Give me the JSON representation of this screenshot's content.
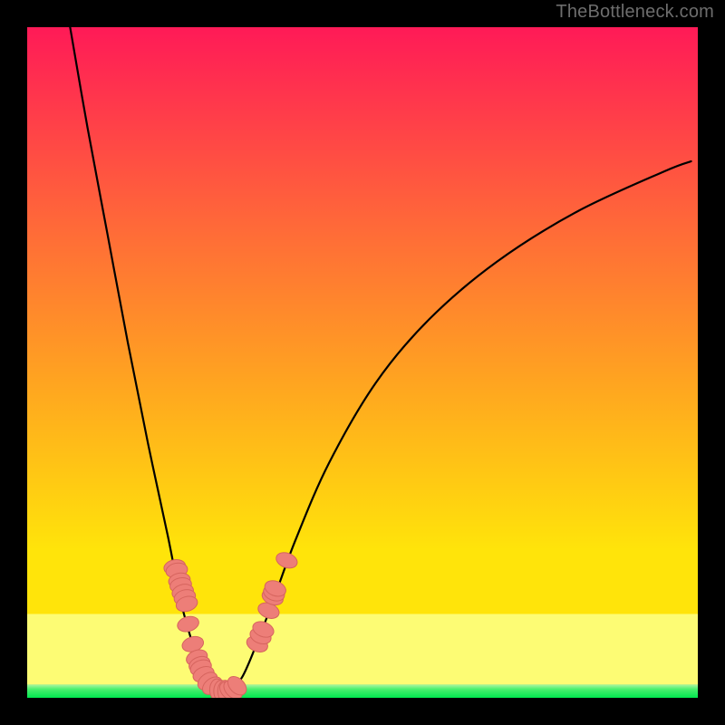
{
  "watermark": "TheBottleneck.com",
  "chart_data": {
    "type": "line",
    "title": "",
    "xlabel": "",
    "ylabel": "",
    "xlim": [
      0,
      100
    ],
    "ylim": [
      0,
      100
    ],
    "grid": false,
    "legend": false,
    "series": [
      {
        "name": "bottleneck-curve",
        "x": [
          6.4,
          9.0,
          12.0,
          15.0,
          18.0,
          21.0,
          23.0,
          25.0,
          26.5,
          28.0,
          30.0,
          32.0,
          34.0,
          36.5,
          40.0,
          45.0,
          52.0,
          60.0,
          70.0,
          82.0,
          95.0,
          99.0
        ],
        "values": [
          100.0,
          85.0,
          69.0,
          53.0,
          38.0,
          24.0,
          14.0,
          7.0,
          3.0,
          1.0,
          1.0,
          3.0,
          7.5,
          14.0,
          23.5,
          35.0,
          47.0,
          56.5,
          65.0,
          72.5,
          78.5,
          80.0
        ]
      }
    ],
    "points": [
      {
        "x": 22.0,
        "y": 19.5
      },
      {
        "x": 22.3,
        "y": 19.0
      },
      {
        "x": 22.7,
        "y": 17.5
      },
      {
        "x": 22.9,
        "y": 16.8
      },
      {
        "x": 23.2,
        "y": 15.8
      },
      {
        "x": 23.5,
        "y": 15.0
      },
      {
        "x": 23.8,
        "y": 14.0
      },
      {
        "x": 24.0,
        "y": 11.0
      },
      {
        "x": 24.7,
        "y": 8.0
      },
      {
        "x": 25.3,
        "y": 6.0
      },
      {
        "x": 25.7,
        "y": 5.0
      },
      {
        "x": 25.9,
        "y": 4.5
      },
      {
        "x": 26.3,
        "y": 3.5
      },
      {
        "x": 26.9,
        "y": 2.5
      },
      {
        "x": 27.6,
        "y": 1.8
      },
      {
        "x": 28.3,
        "y": 1.2
      },
      {
        "x": 28.9,
        "y": 1.0
      },
      {
        "x": 29.5,
        "y": 1.0
      },
      {
        "x": 30.1,
        "y": 1.0
      },
      {
        "x": 30.7,
        "y": 1.2
      },
      {
        "x": 31.3,
        "y": 1.8
      },
      {
        "x": 34.3,
        "y": 8.0
      },
      {
        "x": 34.8,
        "y": 9.2
      },
      {
        "x": 35.2,
        "y": 10.2
      },
      {
        "x": 36.0,
        "y": 13.0
      },
      {
        "x": 36.6,
        "y": 15.0
      },
      {
        "x": 36.8,
        "y": 15.6
      },
      {
        "x": 37.0,
        "y": 16.3
      },
      {
        "x": 38.7,
        "y": 20.5
      }
    ],
    "colors": {
      "top": "#ff1a57",
      "mid_red_orange": "#ff6a38",
      "mid_orange": "#ffa221",
      "mid_yellow": "#ffe40a",
      "pale_yellow": "#fdfc74",
      "green": "#00e84f",
      "curve": "#000000",
      "point_fill": "#ed7e78",
      "point_stroke": "#d6645e"
    },
    "bands": {
      "green_y": 2.0,
      "pale_y_top": 12.5,
      "gradient_y_top": 100.0
    }
  }
}
